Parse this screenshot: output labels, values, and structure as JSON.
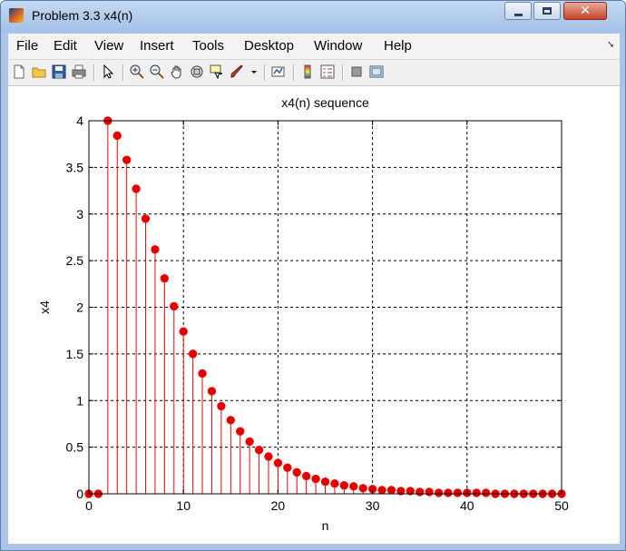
{
  "window": {
    "title": "Problem 3.3 x4(n)"
  },
  "menu": {
    "items": [
      "File",
      "Edit",
      "View",
      "Insert",
      "Tools",
      "Desktop",
      "Window",
      "Help"
    ]
  },
  "toolbar": {
    "icons": [
      "new-figure-icon",
      "open-file-icon",
      "save-icon",
      "print-icon",
      "pointer-icon",
      "zoom-in-icon",
      "zoom-out-icon",
      "pan-hand-icon",
      "rotate-3d-icon",
      "data-cursor-icon",
      "brush-icon",
      "dropdown-arrow-icon",
      "link-plot-icon",
      "colorbar-icon",
      "legend-icon",
      "hide-plot-tools-icon",
      "show-plot-tools-icon"
    ]
  },
  "colors": {
    "stem": "#ff0000",
    "marker_fill": "#dd0000",
    "grid": "#000000",
    "title_bar": "#a9c4e6"
  },
  "chart_data": {
    "type": "stem",
    "title": "x4(n) sequence",
    "xlabel": "n",
    "ylabel": "x4",
    "xlim": [
      0,
      50
    ],
    "ylim": [
      0,
      4
    ],
    "xticks": [
      0,
      10,
      20,
      30,
      40,
      50
    ],
    "yticks": [
      0,
      0.5,
      1,
      1.5,
      2,
      2.5,
      3,
      3.5,
      4
    ],
    "ytick_labels": [
      "0",
      "0.5",
      "1",
      "1.5",
      "2",
      "2.5",
      "3",
      "3.5",
      "4"
    ],
    "grid": true,
    "x": [
      0,
      1,
      2,
      3,
      4,
      5,
      6,
      7,
      8,
      9,
      10,
      11,
      12,
      13,
      14,
      15,
      16,
      17,
      18,
      19,
      20,
      21,
      22,
      23,
      24,
      25,
      26,
      27,
      28,
      29,
      30,
      31,
      32,
      33,
      34,
      35,
      36,
      37,
      38,
      39,
      40,
      41,
      42,
      43,
      44,
      45,
      46,
      47,
      48,
      49,
      50
    ],
    "y": [
      0,
      0,
      4.0,
      3.84,
      3.58,
      3.27,
      2.95,
      2.62,
      2.31,
      2.01,
      1.74,
      1.5,
      1.29,
      1.1,
      0.94,
      0.79,
      0.67,
      0.56,
      0.47,
      0.4,
      0.33,
      0.28,
      0.23,
      0.19,
      0.16,
      0.13,
      0.11,
      0.09,
      0.08,
      0.06,
      0.05,
      0.04,
      0.04,
      0.03,
      0.03,
      0.02,
      0.02,
      0.01,
      0.01,
      0.01,
      0.01,
      0.01,
      0.01,
      0.0,
      0.0,
      0.0,
      0.0,
      0.0,
      0.0,
      0.0,
      0.0
    ]
  }
}
